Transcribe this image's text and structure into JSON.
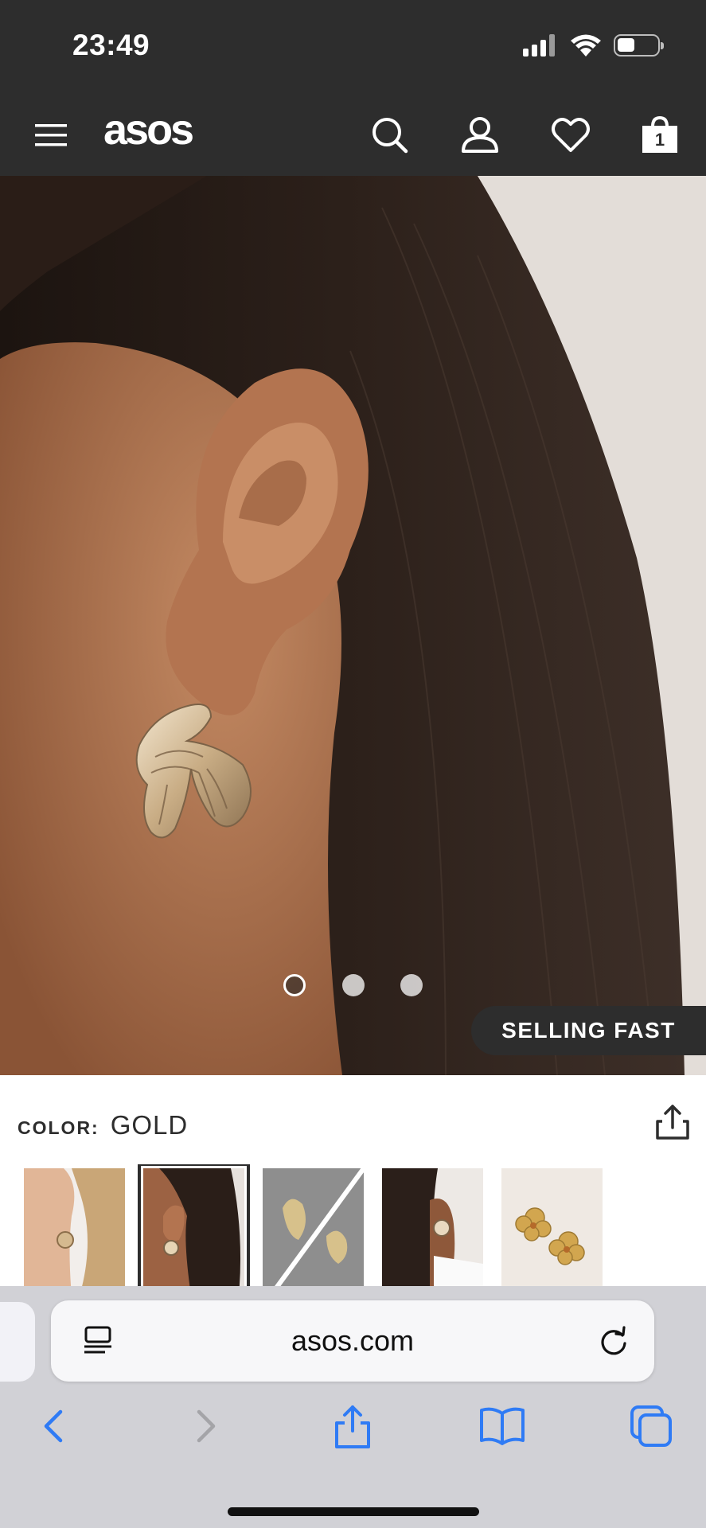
{
  "status_bar": {
    "time": "23:49"
  },
  "site_header": {
    "logo": "asos",
    "bag_count": "1"
  },
  "hero": {
    "badge": "SELLING FAST",
    "active_slide": 1,
    "slide_count": 3
  },
  "product": {
    "color_label": "COLOR:",
    "color_value": "GOLD"
  },
  "browser": {
    "url": "asos.com"
  },
  "colors": {
    "header_bg": "#2d2d2d",
    "safari_blue": "#2f7bf5"
  },
  "icons": [
    "menu-icon",
    "search-icon",
    "account-icon",
    "heart-icon",
    "bag-icon",
    "share-icon",
    "reader-icon",
    "reload-icon",
    "back-icon",
    "forward-icon",
    "bookmarks-icon",
    "tabs-icon"
  ]
}
